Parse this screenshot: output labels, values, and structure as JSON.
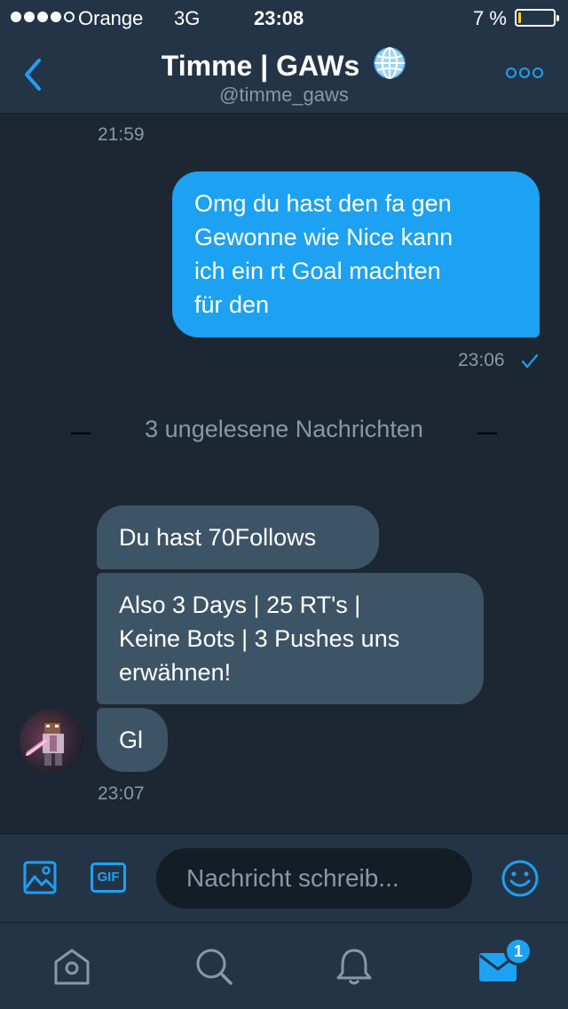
{
  "status_bar": {
    "carrier": "Orange",
    "network": "3G",
    "time": "23:08",
    "battery_percent": "7 %",
    "battery_level": 0.07
  },
  "header": {
    "title": "Timme | GAWs",
    "handle": "@timme_gaws",
    "back_icon": "chevron-left-icon",
    "more_icon": "more-dots-icon",
    "verified_badge_icon": "globe-icon"
  },
  "messages": {
    "top_timestamp": "21:59",
    "outgoing": [
      {
        "lines": [
          "Omg du hast den fa gen",
          "Gewonne  wie Nice kann",
          "ich ein rt Goal machten",
          "für den"
        ],
        "timestamp": "23:06",
        "status_icon": "checkmark-icon"
      }
    ],
    "unread_divider": "3 ungelesene Nachrichten",
    "incoming": [
      {
        "lines": [
          "Du hast 70Follows"
        ]
      },
      {
        "lines": [
          "Also 3 Days | 25 RT's |",
          "Keine Bots | 3 Pushes uns",
          "erwähnen!"
        ]
      },
      {
        "lines": [
          "Gl"
        ]
      }
    ],
    "incoming_timestamp": "23:07"
  },
  "compose": {
    "placeholder": "Nachricht schreib...",
    "photo_icon": "image-icon",
    "gif_label": "GIF",
    "emoji_icon": "smiley-icon"
  },
  "tabbar": {
    "items": [
      "home-icon",
      "search-icon",
      "notifications-bell-icon",
      "messages-envelope-icon"
    ],
    "messages_badge": "1"
  },
  "colors": {
    "background": "#1c2733",
    "bar": "#243447",
    "accent": "#1da1f2",
    "incoming_bubble": "#3d5466",
    "muted_text": "#8899a6",
    "battery": "#ffd21f"
  }
}
